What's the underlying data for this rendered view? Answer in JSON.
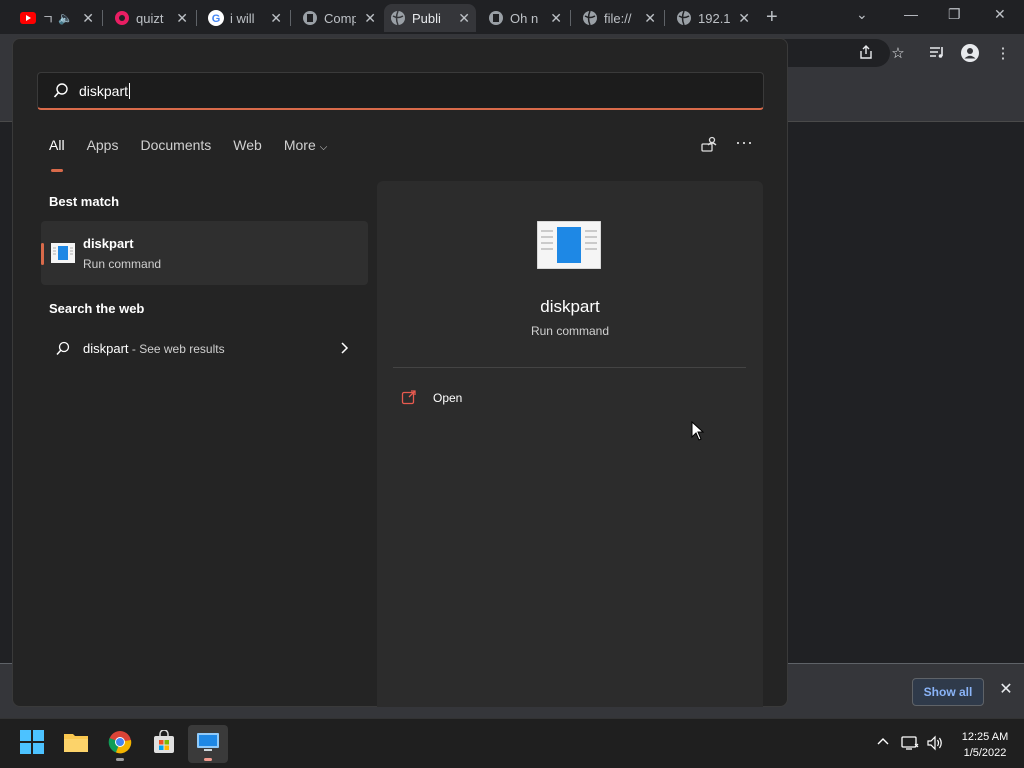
{
  "browser": {
    "tabs": [
      {
        "label": "ㄱ",
        "icon": "youtube-icon"
      },
      {
        "label": "quizt",
        "icon": "quiz-icon"
      },
      {
        "label": "i will",
        "icon": "google-icon"
      },
      {
        "label": "Comp",
        "icon": "site-icon"
      },
      {
        "label": "Publi",
        "icon": "globe-icon"
      },
      {
        "label": "Oh n",
        "icon": "site-icon"
      },
      {
        "label": "file://",
        "icon": "globe-icon"
      },
      {
        "label": "192.1",
        "icon": "globe-icon"
      }
    ],
    "download_bar": {
      "show_all_label": "Show all"
    }
  },
  "search_panel": {
    "query": "diskpart",
    "filters": [
      "All",
      "Apps",
      "Documents",
      "Web",
      "More"
    ],
    "best_match_heading": "Best match",
    "best_match": {
      "title": "diskpart",
      "subtitle": "Run command"
    },
    "web_heading": "Search the web",
    "web_result": {
      "query": "diskpart",
      "suffix": " - See web results"
    },
    "preview": {
      "title": "diskpart",
      "subtitle": "Run command",
      "actions": [
        {
          "label": "Open",
          "icon": "open-icon"
        }
      ]
    }
  },
  "taskbar": {
    "apps": [
      "start-icon",
      "file-explorer-icon",
      "chrome-icon",
      "store-icon",
      "remote-desktop-icon"
    ],
    "clock": {
      "time": "12:25 AM",
      "date": "1/5/2022"
    }
  },
  "colors": {
    "accent": "#d86a4a",
    "link": "#8ab4f8"
  }
}
